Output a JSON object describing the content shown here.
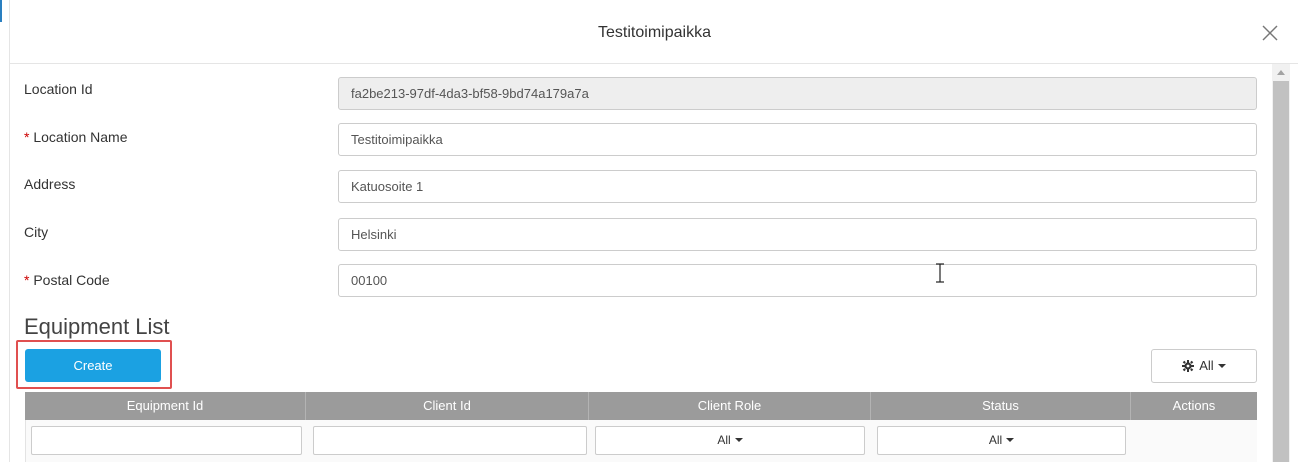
{
  "modal": {
    "title": "Testitoimipaikka"
  },
  "form": {
    "location_id": {
      "label": "Location Id",
      "value": "fa2be213-97df-4da3-bf58-9bd74a179a7a"
    },
    "location_name": {
      "label": "Location Name",
      "required_mark": "*",
      "value": "Testitoimipaikka"
    },
    "address": {
      "label": "Address",
      "value": "Katuosoite 1"
    },
    "city": {
      "label": "City",
      "value": "Helsinki"
    },
    "postal_code": {
      "label": "Postal Code",
      "required_mark": "*",
      "value": "00100"
    }
  },
  "equipment": {
    "title": "Equipment List",
    "create_label": "Create",
    "column_filter_label": "All",
    "columns": [
      "Equipment Id",
      "Client Id",
      "Client Role",
      "Status",
      "Actions"
    ],
    "filters": {
      "client_role": "All",
      "status": "All"
    }
  },
  "colors": {
    "primary": "#1ba1e2",
    "header_bg": "#9b9b9b",
    "highlight": "#e05050",
    "required": "#cc0000"
  },
  "icons": {
    "close": "close-icon",
    "settings": "gear-icon",
    "scroll_up": "chevron-up-icon",
    "text_cursor": "i-beam-cursor-icon"
  }
}
